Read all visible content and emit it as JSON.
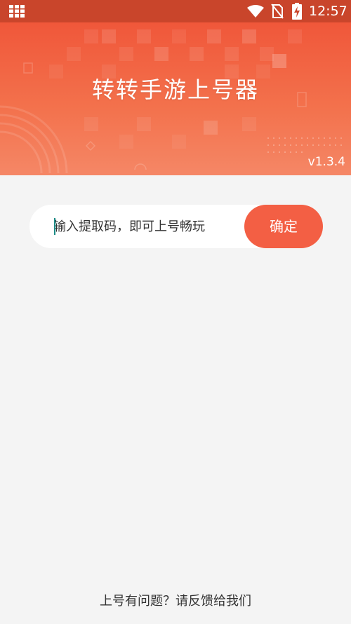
{
  "status_bar": {
    "time": "12:57",
    "icons": [
      "app-grid-icon",
      "wifi-icon",
      "no-sim-icon",
      "battery-charging-icon"
    ]
  },
  "banner": {
    "title": "转转手游上号器",
    "version": "v1.3.4"
  },
  "code_entry": {
    "placeholder": "输入提取码，即可上号畅玩",
    "value": "",
    "confirm_label": "确定"
  },
  "footer": {
    "feedback_text": "上号有问题？请反馈给我们"
  },
  "colors": {
    "accent": "#f35f44",
    "banner_top": "#f0573a",
    "banner_bottom": "#f58766",
    "status_bar": "#c9452b",
    "background": "#f4f4f4",
    "caret": "#1b8b86"
  }
}
